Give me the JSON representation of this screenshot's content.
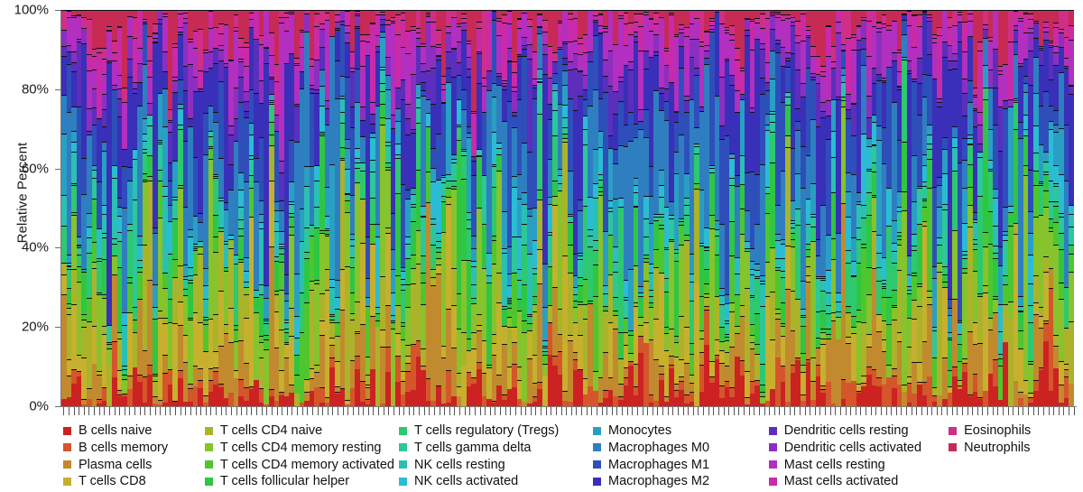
{
  "chart_data": {
    "type": "bar",
    "title": "",
    "subtitle": "",
    "xlabel": "",
    "ylabel": "Relative Percent",
    "ylim": [
      0,
      100
    ],
    "grid": false,
    "stacked": true,
    "stack_mode": "percent",
    "legend_position": "bottom",
    "legend_columns": 5,
    "bar_count": 200,
    "ytick_labels": [
      "0%",
      "20%",
      "40%",
      "60%",
      "80%",
      "100%"
    ],
    "ytick_values": [
      0,
      20,
      40,
      60,
      80,
      100
    ],
    "categories_note": "200 unlabeled tumor samples along x-axis (tick marks only, no text labels)",
    "series": [
      {
        "name": "B cells naive",
        "color": "#cc2222"
      },
      {
        "name": "B cells memory",
        "color": "#d4562a"
      },
      {
        "name": "Plasma cells",
        "color": "#c28a2e"
      },
      {
        "name": "T cells CD8",
        "color": "#c6b02e"
      },
      {
        "name": "T cells CD4 naive",
        "color": "#aab32a"
      },
      {
        "name": "T cells CD4 memory resting",
        "color": "#86c32c"
      },
      {
        "name": "T cells CD4 memory activated",
        "color": "#4fc62e"
      },
      {
        "name": "T cells follicular helper",
        "color": "#2fc643"
      },
      {
        "name": "T cells regulatory (Tregs)",
        "color": "#2ec870"
      },
      {
        "name": "T cells gamma delta",
        "color": "#2cc79a"
      },
      {
        "name": "NK cells resting",
        "color": "#2bc0b4"
      },
      {
        "name": "NK cells activated",
        "color": "#2bbcd4"
      },
      {
        "name": "Monocytes",
        "color": "#2a9fc4"
      },
      {
        "name": "Macrophages M0",
        "color": "#2f7fc0"
      },
      {
        "name": "Macrophages M1",
        "color": "#2e4fba"
      },
      {
        "name": "Macrophages M2",
        "color": "#3a2fb8"
      },
      {
        "name": "Dendritic cells resting",
        "color": "#5b2ebc"
      },
      {
        "name": "Dendritic cells activated",
        "color": "#8c2fc0"
      },
      {
        "name": "Mast cells resting",
        "color": "#b22fbf"
      },
      {
        "name": "Mast cells activated",
        "color": "#c92aa8"
      },
      {
        "name": "Eosinophils",
        "color": "#cf2f86"
      },
      {
        "name": "Neutrophils",
        "color": "#c62a55"
      }
    ]
  },
  "axis": {
    "y_title": "Relative Percent",
    "ticks": [
      {
        "label": "100%",
        "value": 100
      },
      {
        "label": "80%",
        "value": 80
      },
      {
        "label": "60%",
        "value": 60
      },
      {
        "label": "40%",
        "value": 40
      },
      {
        "label": "20%",
        "value": 20
      },
      {
        "label": "0%",
        "value": 0
      }
    ]
  },
  "legend": {
    "columns": [
      {
        "items": [
          {
            "label": "B cells naive",
            "color": "#cc2222"
          },
          {
            "label": "B cells memory",
            "color": "#d4562a"
          },
          {
            "label": "Plasma cells",
            "color": "#c28a2e"
          },
          {
            "label": "T cells CD8",
            "color": "#c6b02e"
          }
        ]
      },
      {
        "items": [
          {
            "label": "T cells CD4 naive",
            "color": "#aab32a"
          },
          {
            "label": "T cells CD4 memory resting",
            "color": "#86c32c"
          },
          {
            "label": "T cells CD4 memory activated",
            "color": "#4fc62e"
          },
          {
            "label": "T cells follicular helper",
            "color": "#2fc643"
          }
        ]
      },
      {
        "items": [
          {
            "label": "T cells regulatory (Tregs)",
            "color": "#2ec870"
          },
          {
            "label": "T cells gamma delta",
            "color": "#2cc79a"
          },
          {
            "label": "NK cells resting",
            "color": "#2bc0b4"
          },
          {
            "label": "NK cells activated",
            "color": "#2bbcd4"
          }
        ]
      },
      {
        "items": [
          {
            "label": "Monocytes",
            "color": "#2a9fc4"
          },
          {
            "label": "Macrophages M0",
            "color": "#2f7fc0"
          },
          {
            "label": "Macrophages M1",
            "color": "#2e4fba"
          },
          {
            "label": "Macrophages M2",
            "color": "#3a2fb8"
          }
        ]
      },
      {
        "items": [
          {
            "label": "Dendritic cells resting",
            "color": "#5b2ebc"
          },
          {
            "label": "Dendritic cells activated",
            "color": "#8c2fc0"
          },
          {
            "label": "Mast cells resting",
            "color": "#b22fbf"
          },
          {
            "label": "Mast cells activated",
            "color": "#c92aa8"
          }
        ]
      },
      {
        "items": [
          {
            "label": "Eosinophils",
            "color": "#cf2f86"
          },
          {
            "label": "Neutrophils",
            "color": "#c62a55"
          }
        ]
      }
    ]
  }
}
